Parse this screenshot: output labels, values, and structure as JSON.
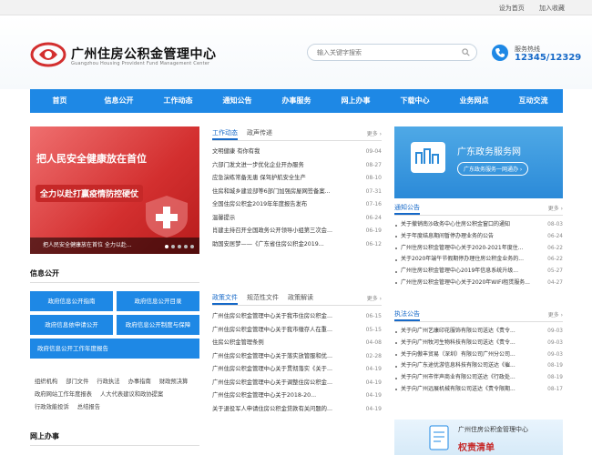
{
  "topbar": {
    "set_home": "设为首页",
    "add_fav": "加入收藏"
  },
  "header": {
    "title": "广州住房公积金管理中心",
    "subtitle": "Guangzhou Housing Provident Fund Management Center",
    "search_placeholder": "输入关键字搜索",
    "hotline_label": "服务热线",
    "hotline_number": "12345/12329"
  },
  "nav": [
    "首页",
    "信息公开",
    "工作动态",
    "通知公告",
    "办事服务",
    "网上办事",
    "下载中心",
    "业务网点",
    "互动交流"
  ],
  "banner": {
    "line1": "把人民安全健康放在首位",
    "line2": "全力以赴打赢疫情防控硬仗",
    "caption": "把人民安全健康放在首位 全力以赴...",
    "dots": 5,
    "active_dot": 1
  },
  "news": {
    "tabs": [
      "工作动态",
      "政声传递"
    ],
    "more": "更多 ›",
    "items": [
      {
        "title": "文明健康 有你有我",
        "date": "09-04"
      },
      {
        "title": "六部门发文进一步优化企业开办服务",
        "date": "08-27"
      },
      {
        "title": "应急演练常备无患 保驾护航安全生产",
        "date": "08-10"
      },
      {
        "title": "住房和城乡建设部等6部门加强房屋网签备案...",
        "date": "07-31"
      },
      {
        "title": "全国住房公积金2019年年度报告发布",
        "date": "07-16"
      },
      {
        "title": "温馨提示",
        "date": "06-24"
      },
      {
        "title": "肖建主持召开全国政务公开领导小组第三次会...",
        "date": "06-19"
      },
      {
        "title": "助国安居梦——《广东省住房公积金2019...",
        "date": "06-12"
      }
    ]
  },
  "info_open": {
    "title": "信息公开",
    "buttons": [
      "政府信息公开指南",
      "政府信息公开目录",
      "政府信息依申请公开",
      "政府信息公开制度与保障",
      "政府信息公开工作年度报告"
    ],
    "links": [
      "组织机构",
      "部门文件",
      "行政执法",
      "办事指南",
      "财政预决算",
      "政府网站工作年度报表",
      "人大代表建议和政协提案",
      "行政效能投诉",
      "总结报告"
    ]
  },
  "online": {
    "title": "网上办事"
  },
  "policy": {
    "tabs": [
      "政策文件",
      "规范性文件",
      "政策解读"
    ],
    "more": "更多 ›",
    "items": [
      {
        "title": "广州住房公积金管理中心关于我市住房公积金...",
        "date": "06-15"
      },
      {
        "title": "广州住房公积金管理中心关于我市缴存人在重...",
        "date": "05-15"
      },
      {
        "title": "住房公积金管理条例",
        "date": "04-08"
      },
      {
        "title": "广州住房公积金管理中心关于落实放管服和优...",
        "date": "02-28"
      },
      {
        "title": "广州住房公积金管理中心关于贯彻落实《关于...",
        "date": "04-19"
      },
      {
        "title": "广州住房公积金管理中心关于调整住房公积金...",
        "date": "04-19"
      },
      {
        "title": "广州住房公积金管理中心关于2018-20...",
        "date": "04-19"
      },
      {
        "title": "关于退役军人申请住房公积金贷款有关问题的...",
        "date": "04-19"
      }
    ]
  },
  "gov_banner": {
    "title": "广东政务服务网",
    "sub": "广东政务服务一网通办 ›"
  },
  "notice": {
    "title": "通知公告",
    "more": "更多 ›",
    "items": [
      {
        "title": "关于撤销南沙政务中心住房公积金窗口的通知",
        "date": "08-03"
      },
      {
        "title": "关于年度结息期间暂停办理业务的公告",
        "date": "06-24"
      },
      {
        "title": "广州住房公积金管理中心关于2020-2021年度住...",
        "date": "06-22"
      },
      {
        "title": "关于2020年端午节假期停办理住房公积金业务的...",
        "date": "06-22"
      },
      {
        "title": "广州住房公积金管理中心2019年信息系统升级...",
        "date": "05-27"
      },
      {
        "title": "广州住房公积金管理中心关于2020年WIFI租赁服务...",
        "date": "04-27"
      }
    ]
  },
  "law": {
    "title": "执法公告",
    "more": "更多 ›",
    "items": [
      {
        "title": "关于向广州艺康印花服饰有限公司送达《责令...",
        "date": "09-03"
      },
      {
        "title": "关于向广州牧河生物科技有限公司送达《责令...",
        "date": "09-03"
      },
      {
        "title": "关于向傲丰贸易（深圳）有限公司广州分公司...",
        "date": "09-03"
      },
      {
        "title": "关于向广东途优游信息科技有限公司送达《催...",
        "date": "08-19"
      },
      {
        "title": "关于向广州市伴声商业有限公司送达《行政处...",
        "date": "08-19"
      },
      {
        "title": "关于向广州远展机械有限公司送达《责令限期...",
        "date": "08-17"
      }
    ]
  },
  "duty": {
    "line1": "广州住房公积金管理中心",
    "line2": "权责清单"
  }
}
